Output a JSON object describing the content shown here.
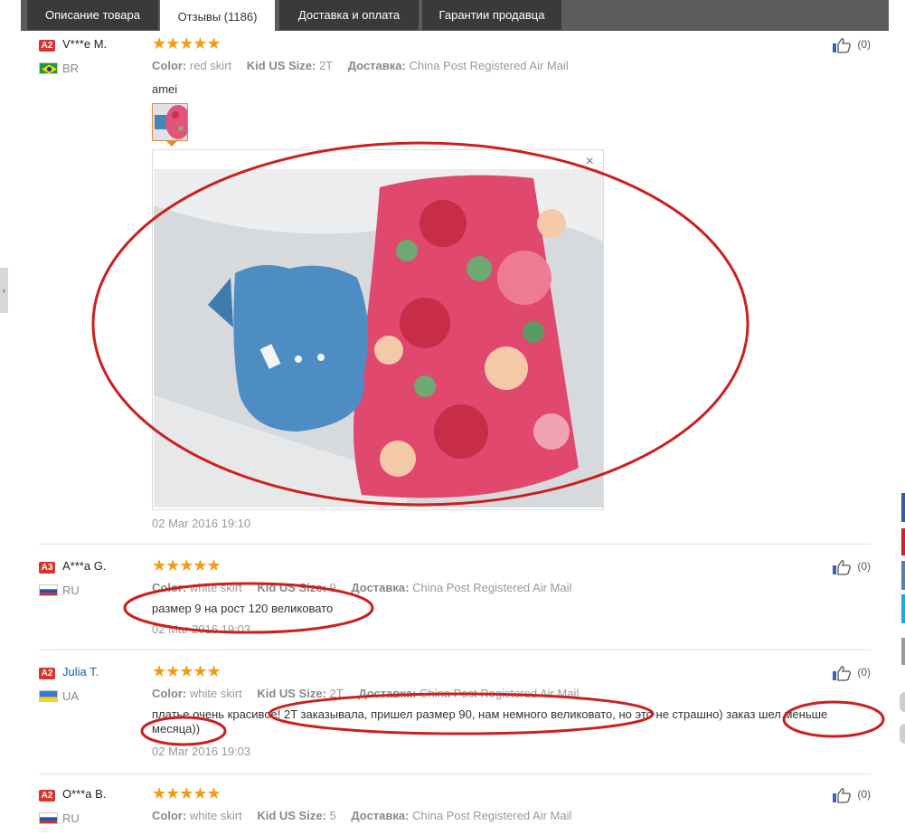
{
  "tabs": [
    {
      "label": "Описание товара",
      "active": false
    },
    {
      "label": "Отзывы (1186)",
      "active": true
    },
    {
      "label": "Доставка и оплата",
      "active": false
    },
    {
      "label": "Гарантии продавца",
      "active": false
    }
  ],
  "labels": {
    "color": "Color:",
    "kid_size": "Kid US Size:",
    "delivery": "Доставка:"
  },
  "colors": {
    "accent_star": "#f39c12",
    "badge": "#d9342c",
    "annotation": "#cc1f1f",
    "link_name": "#1a5fa8"
  },
  "side_handle": "‹",
  "viewer_close": "×",
  "reviews": [
    {
      "level": "A2",
      "name": "V***e M.",
      "country": "BR",
      "stars": "★★★★★",
      "color": "red skirt",
      "size": "2T",
      "delivery": "China Post Registered Air Mail",
      "text": "amei",
      "date": "02 Mar 2016 19:10",
      "likes": "(0)"
    },
    {
      "level": "A3",
      "name": "A***a G.",
      "country": "RU",
      "stars": "★★★★★",
      "color": "white skirt",
      "size": "9",
      "delivery": "China Post Registered Air Mail",
      "text": "размер 9 на рост 120 великовато",
      "date": "02 Mar 2016 19:03",
      "likes": "(0)"
    },
    {
      "level": "A2",
      "name": "Julia T.",
      "country": "UA",
      "stars": "★★★★★",
      "color": "white skirt",
      "size": "2T",
      "delivery": "China Post Registered Air Mail",
      "text_line1": "платье очень красивое! 2T заказывала, пришел размер 90, нам немного великовато, но это не страшно) заказ шел меньше",
      "text_line2": "месяца))",
      "date": "02 Mar 2016 19:03",
      "likes": "(0)"
    },
    {
      "level": "A2",
      "name": "O***a B.",
      "country": "RU",
      "stars": "★★★★★",
      "color": "white skirt",
      "size": "5",
      "delivery": "China Post Registered Air Mail",
      "likes": "(0)"
    }
  ]
}
